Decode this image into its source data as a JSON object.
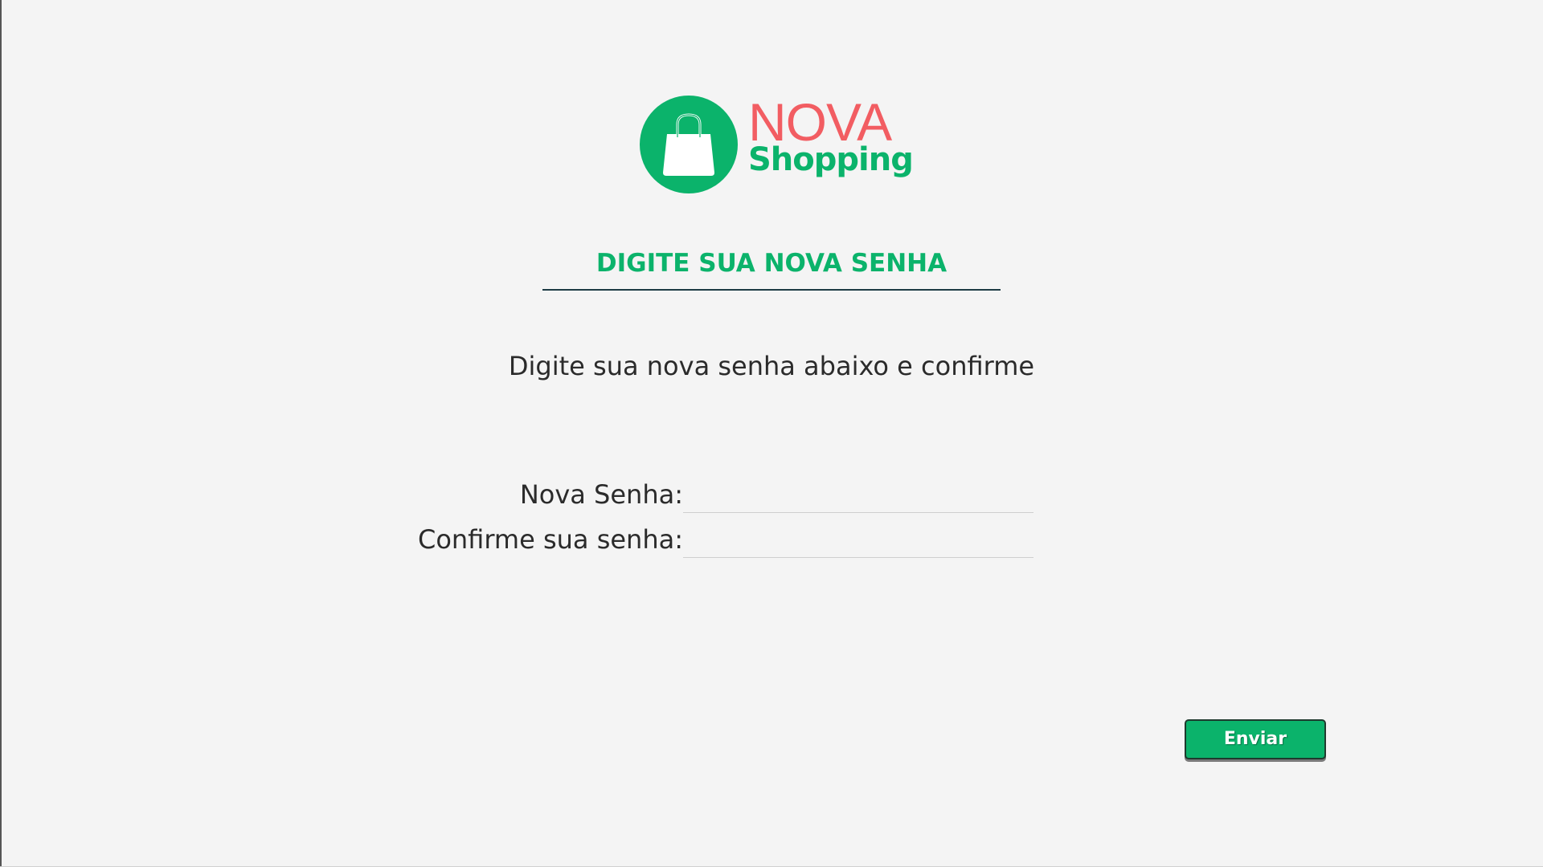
{
  "colors": {
    "brand_green": "#0bb36b",
    "brand_red": "#f25d62",
    "heading_rule": "#1d3b44",
    "background": "#f4f4f4"
  },
  "logo": {
    "icon": "shopping-bag-icon",
    "word_nova": "NOVA",
    "word_shopping": "Shopping"
  },
  "heading": "DIGITE SUA NOVA SENHA",
  "instruction": "Digite sua nova senha abaixo e confirme",
  "form": {
    "new_password_label": "Nova Senha:",
    "new_password_value": "",
    "confirm_password_label": "Confirme sua senha:",
    "confirm_password_value": ""
  },
  "submit_label": "Enviar"
}
